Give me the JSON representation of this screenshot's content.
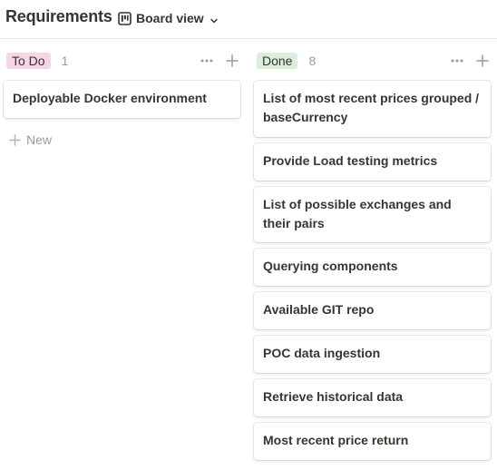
{
  "header": {
    "title": "Requirements",
    "view_label": "Board view",
    "view_icon": "board-icon"
  },
  "columns": [
    {
      "label": "To Do",
      "count": "1",
      "tag_color": "#f5d5e6",
      "cards": [
        "Deployable Docker environment"
      ],
      "new_label": "New"
    },
    {
      "label": "Done",
      "count": "8",
      "tag_color": "#dbeddb",
      "cards": [
        "List of most recent prices grouped / baseCurrency",
        "Provide Load testing metrics",
        "List of possible exchanges and their pairs",
        "Querying components",
        "Available GIT repo",
        "POC data ingestion",
        "Retrieve historical data",
        "Most recent price return"
      ]
    }
  ]
}
